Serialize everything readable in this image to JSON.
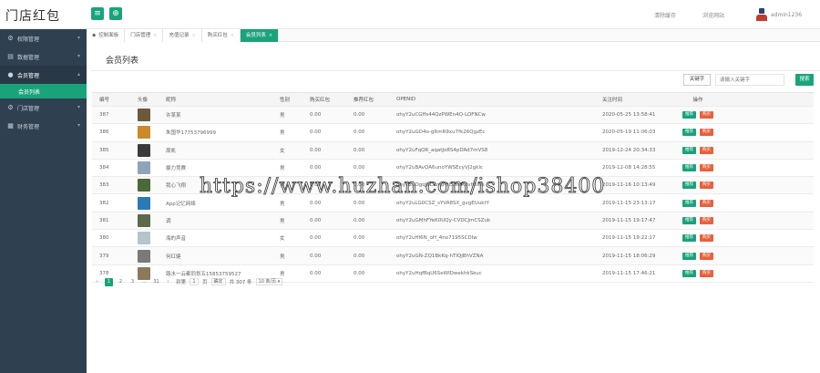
{
  "brand": "门店红包",
  "top_links": {
    "clear_cache": "清除缓存",
    "browse_site": "浏览网站",
    "username": "admin1236"
  },
  "sidebar": {
    "items": [
      {
        "label": "权限管理",
        "icon": "gear-icon",
        "glyph": "⚙"
      },
      {
        "label": "数据管理",
        "icon": "database-icon",
        "glyph": "▤"
      },
      {
        "label": "会员管理",
        "icon": "users-icon",
        "glyph": "●"
      },
      {
        "label": "门店管理",
        "icon": "store-icon",
        "glyph": "⚙"
      },
      {
        "label": "财务管理",
        "icon": "finance-icon",
        "glyph": "▦"
      }
    ],
    "sub_active": "会员列表"
  },
  "tabs": [
    "控制面板",
    "门店管理",
    "充值记录",
    "购买红包",
    "会员列表"
  ],
  "panel": {
    "title": "会员列表",
    "keyword_btn": "关键字",
    "search_placeholder": "请输入关键字",
    "search_btn": "搜索"
  },
  "table": {
    "headers": [
      "编号",
      "头像",
      "昵称",
      "性别",
      "购买红包",
      "推荐红包",
      "OPENID",
      "关注时间",
      "操作"
    ],
    "actions": {
      "recommend": "推荐",
      "buy": "购买"
    },
    "rows": [
      {
        "id": "387",
        "name": "许某某",
        "sex": "男",
        "buy": "0.00",
        "rec": "0.00",
        "openid": "ohyY2uCGffs44QzPWEn4Q-LOFNCw",
        "time": "2020-05-25 13:58:41",
        "avatar_color": "#6b5a3a"
      },
      {
        "id": "386",
        "name": "朱国华17753796999",
        "sex": "男",
        "buy": "0.00",
        "rec": "0.00",
        "openid": "ohyY2uGD4o-gRmR9xu7fk26QgzEc",
        "time": "2020-05-19 11:06:03",
        "avatar_color": "#c98a2a"
      },
      {
        "id": "385",
        "name": "周凯",
        "sex": "女",
        "buy": "0.00",
        "rec": "0.00",
        "openid": "ohyY2uFqQR_aqatJo8S4pDAd7mVS8",
        "time": "2019-12-24 20:34:33",
        "avatar_color": "#3a3a3a"
      },
      {
        "id": "384",
        "name": "摄力竞赛",
        "sex": "男",
        "buy": "0.00",
        "rec": "0.00",
        "openid": "ohyY2uBAvQA6unoYWSEcyVJ2gklc",
        "time": "2019-12-08 14:28:55",
        "avatar_color": "#8fa4b8"
      },
      {
        "id": "383",
        "name": "我心飞翔",
        "sex": "男",
        "buy": "0.00",
        "rec": "0.00",
        "openid": "ohyY2uOgqJbLRnqPBE2xzRSvh6Ws",
        "time": "2019-11-16 10:13:49",
        "avatar_color": "#4a6a3a"
      },
      {
        "id": "382",
        "name": "App记忆网络",
        "sex": "男",
        "buy": "0.00",
        "rec": "0.00",
        "openid": "ohyY2uLG0CSZ_sYVA8SX_gvgEUuktY",
        "time": "2019-11-15 23:13:17",
        "avatar_color": "#2a7ab8"
      },
      {
        "id": "381",
        "name": "调",
        "sex": "男",
        "buy": "0.00",
        "rec": "0.00",
        "openid": "ohyY2uGMhFYeK0UQy-CVDCJmCSZuk",
        "time": "2019-11-15 19:17:47",
        "avatar_color": "#5a6a4a"
      },
      {
        "id": "380",
        "name": "海的声音",
        "sex": "女",
        "buy": "0.00",
        "rec": "0.00",
        "openid": "ohyY2uHl6N_oH_4no7195SCDIw",
        "time": "2019-11-15 19:22:17",
        "avatar_color": "#b8c4cc"
      },
      {
        "id": "379",
        "name": "何红健",
        "sex": "男",
        "buy": "0.00",
        "rec": "0.00",
        "openid": "ohyY2uGN-ZQ1BkKq-hTIQjBhVZNA",
        "time": "2019-11-15 18:06:29",
        "avatar_color": "#7a7a7a"
      },
      {
        "id": "378",
        "name": "路水一云都同划五15853759527",
        "sex": "男",
        "buy": "0.00",
        "rec": "0.00",
        "openid": "ohyY2uHqfBqU6SeWlDwekhkSkuc",
        "time": "2019-11-15 17:46:21",
        "avatar_color": "#8a7a5a"
      }
    ]
  },
  "pager": {
    "prev": "‹",
    "pages": [
      "1",
      "2",
      "3",
      "...",
      "31"
    ],
    "next": "›",
    "goto_label": "到第",
    "goto_value": "1",
    "page_unit": "页",
    "go_btn": "确定",
    "total": "共 307 条",
    "per_page": "10 条/页"
  },
  "watermark": "https://www.huzhan.com/ishop38400",
  "colors": {
    "accent": "#1aa37a",
    "danger": "#e8603c",
    "sidebar": "#2f4050"
  }
}
